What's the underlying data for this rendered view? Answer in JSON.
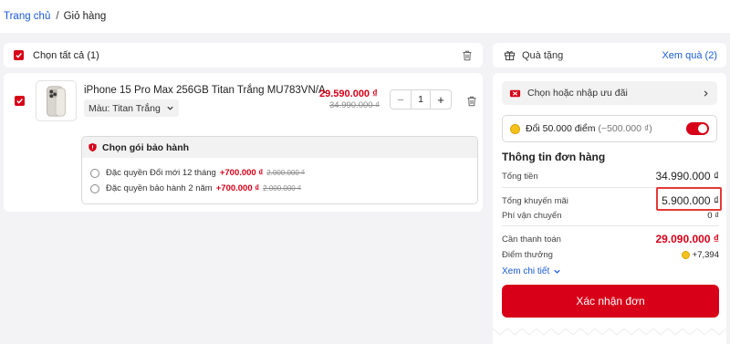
{
  "breadcrumb": {
    "home": "Trang chủ",
    "separator": "/",
    "current": "Giỏ hàng"
  },
  "cart": {
    "select_all_label": "Chọn tất cả (1)",
    "item": {
      "name": "iPhone 15 Pro Max 256GB Titan Trắng MU783VN/A",
      "variant": "Màu: Titan Trắng",
      "price_now": "29.590.000 ₫",
      "price_old": "34.990.000 ₫",
      "quantity": "1",
      "checked": true
    },
    "warranty": {
      "title": "Chọn gói bảo hành",
      "options": [
        {
          "label": "Đặc quyền Đổi mới 12 tháng",
          "price": "+700.000 ₫",
          "old_price": "2.000.000 ₫"
        },
        {
          "label": "Đặc quyền bảo hành 2 năm",
          "price": "+700.000 ₫",
          "old_price": "2.000.000 ₫"
        }
      ]
    }
  },
  "gift": {
    "label": "Quà tặng",
    "link": "Xem quà (2)"
  },
  "summary": {
    "promo_label": "Chọn hoặc nhập ưu đãi",
    "points_label": "Đổi 50.000 điểm",
    "points_value": "(~500.000 ₫)",
    "points_enabled": true,
    "title": "Thông tin đơn hàng",
    "total_label": "Tổng tiền",
    "total_value": "34.990.000 ₫",
    "discount_label": "Tổng khuyến mãi",
    "discount_value": "5.900.000 ₫",
    "shipping_label": "Phí vận chuyển",
    "shipping_value": "0 ₫",
    "pay_label": "Cần thanh toán",
    "pay_value": "29.090.000 ₫",
    "reward_label": "Điểm thưởng",
    "reward_value": "+7,394",
    "details_link": "Xem chi tiết",
    "confirm_label": "Xác nhận đơn"
  },
  "colors": {
    "accent": "#d70018",
    "link": "#1a5bd6",
    "highlight_box": "#e53935"
  }
}
